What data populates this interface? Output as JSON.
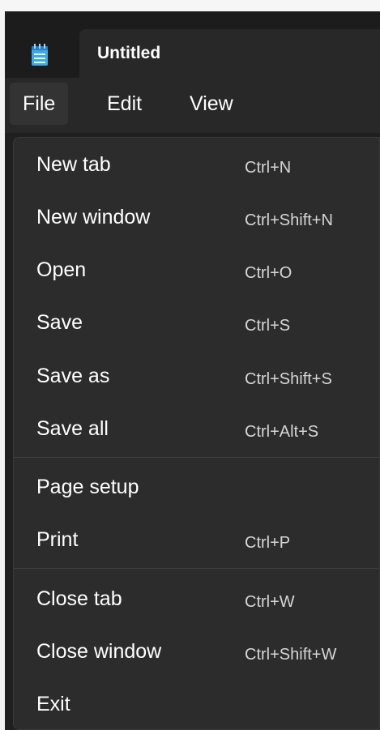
{
  "window": {
    "tab_title": "Untitled",
    "app_icon": "notepad-icon"
  },
  "menubar": {
    "items": [
      {
        "label": "File",
        "active": true
      },
      {
        "label": "Edit",
        "active": false
      },
      {
        "label": "View",
        "active": false
      }
    ]
  },
  "file_menu": {
    "items": [
      {
        "label": "New tab",
        "shortcut": "Ctrl+N"
      },
      {
        "label": "New window",
        "shortcut": "Ctrl+Shift+N"
      },
      {
        "label": "Open",
        "shortcut": "Ctrl+O"
      },
      {
        "label": "Save",
        "shortcut": "Ctrl+S"
      },
      {
        "label": "Save as",
        "shortcut": "Ctrl+Shift+S"
      },
      {
        "label": "Save all",
        "shortcut": "Ctrl+Alt+S"
      },
      {
        "label": "Page setup",
        "shortcut": ""
      },
      {
        "label": "Print",
        "shortcut": "Ctrl+P"
      },
      {
        "label": "Close tab",
        "shortcut": "Ctrl+W"
      },
      {
        "label": "Close window",
        "shortcut": "Ctrl+Shift+W"
      },
      {
        "label": "Exit",
        "shortcut": ""
      }
    ]
  },
  "colors": {
    "window_bg": "#202020",
    "menu_bg": "#2c2c2c",
    "text": "#ffffff",
    "shortcut_text": "#d6d6d6",
    "icon_blue": "#3fa9e8"
  }
}
